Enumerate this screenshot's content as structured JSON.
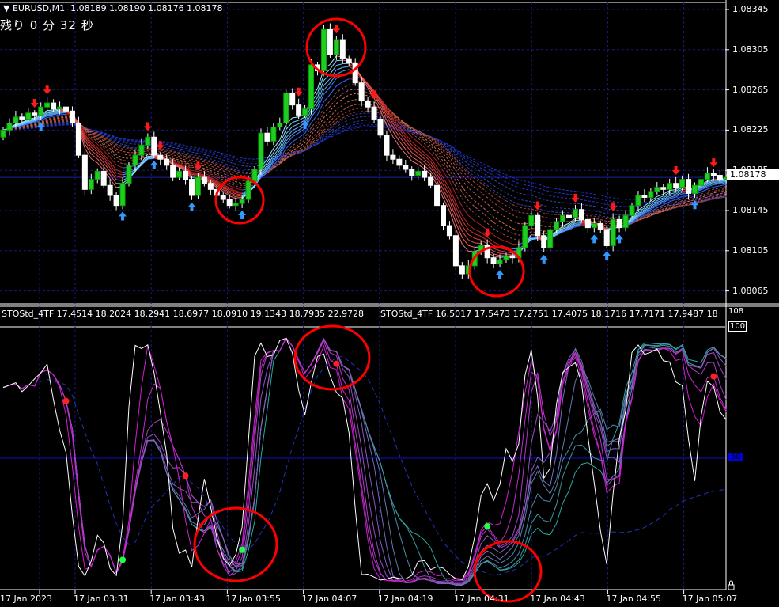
{
  "header": {
    "symbol_label": "EURUSD,M1",
    "ohlc": "1.08189 1.08190 1.08176 1.08178"
  },
  "countdown": "残り 0 分 32 秒",
  "price_axis": {
    "ticks": [
      "1.08345",
      "1.08305",
      "1.08265",
      "1.08225",
      "1.08185",
      "1.08145",
      "1.08105",
      "1.08065"
    ],
    "bid_label": "1.08178"
  },
  "indicator": {
    "label_1": "STOStd_4TF 17.4514 18.2024 18.2941 18.6977 18.0910 19.1343 18.7935 22.9728",
    "label_2": "STOStd_4TF 16.5017 17.5473 17.2751 17.4075 18.1716 17.7171 17.9487 18"
  },
  "stoch_axis": {
    "top": "108",
    "upper": "100",
    "mid": "50"
  },
  "time_axis": [
    "17 Jan 2023",
    "17 Jan 03:31",
    "17 Jan 03:43",
    "17 Jan 03:55",
    "17 Jan 04:07",
    "17 Jan 04:19",
    "17 Jan 04:31",
    "17 Jan 04:43",
    "17 Jan 04:55",
    "17 Jan 05:07"
  ],
  "colors": {
    "bull": "#22cc22",
    "bear": "#ffffff",
    "grid": "#1a1a7a",
    "sell_arrow": "#ff1a1a",
    "buy_arrow": "#3399ff",
    "annotation": "#ff0000"
  },
  "chart_data": {
    "type": "candlestick",
    "title": "EURUSD,M1",
    "ylim": [
      1.08065,
      1.08345
    ],
    "stoch_ylim": [
      0,
      108
    ],
    "bid": 1.08178,
    "closes": [
      1.08225,
      1.08232,
      1.08238,
      1.08236,
      1.08242,
      1.0824,
      1.08248,
      1.08252,
      1.08246,
      1.08248,
      1.08244,
      1.08232,
      1.082,
      1.08166,
      1.08176,
      1.08184,
      1.0817,
      1.0816,
      1.0815,
      1.08172,
      1.0819,
      1.082,
      1.0821,
      1.08218,
      1.082,
      1.08196,
      1.0819,
      1.08178,
      1.08184,
      1.08176,
      1.0816,
      1.08178,
      1.08172,
      1.08166,
      1.0816,
      1.08156,
      1.0815,
      1.08152,
      1.08156,
      1.08174,
      1.08186,
      1.08222,
      1.08214,
      1.08228,
      1.08232,
      1.08262,
      1.0825,
      1.0824,
      1.08246,
      1.0829,
      1.08284,
      1.08325,
      1.083,
      1.08315,
      1.08296,
      1.08292,
      1.08272,
      1.08254,
      1.08248,
      1.08236,
      1.0822,
      1.082,
      1.08196,
      1.0819,
      1.08186,
      1.0818,
      1.08184,
      1.08178,
      1.0817,
      1.0815,
      1.0813,
      1.0812,
      1.0809,
      1.08082,
      1.0809,
      1.08104,
      1.0811,
      1.08098,
      1.08092,
      1.08096,
      1.081,
      1.08098,
      1.08108,
      1.0813,
      1.0814,
      1.0812,
      1.08108,
      1.08126,
      1.08134,
      1.0814,
      1.08138,
      1.08146,
      1.08136,
      1.08128,
      1.08132,
      1.08126,
      1.0811,
      1.08136,
      1.08128,
      1.0814,
      1.0815,
      1.0816,
      1.08158,
      1.08164,
      1.08168,
      1.08166,
      1.08172,
      1.08168,
      1.08176,
      1.08162,
      1.0817,
      1.08176,
      1.08182,
      1.0818,
      1.08176,
      1.08178
    ],
    "first_open": 1.08218,
    "sell_signals": [
      5,
      7,
      23,
      25,
      31,
      47,
      53,
      59,
      77,
      85,
      91,
      97,
      107,
      113
    ],
    "buy_signals": [
      6,
      19,
      24,
      30,
      38,
      48,
      79,
      86,
      94,
      96,
      98,
      110
    ],
    "stoch_red_dots": [
      10,
      29,
      53,
      113
    ],
    "stoch_green_dots": [
      19,
      38,
      77
    ]
  }
}
